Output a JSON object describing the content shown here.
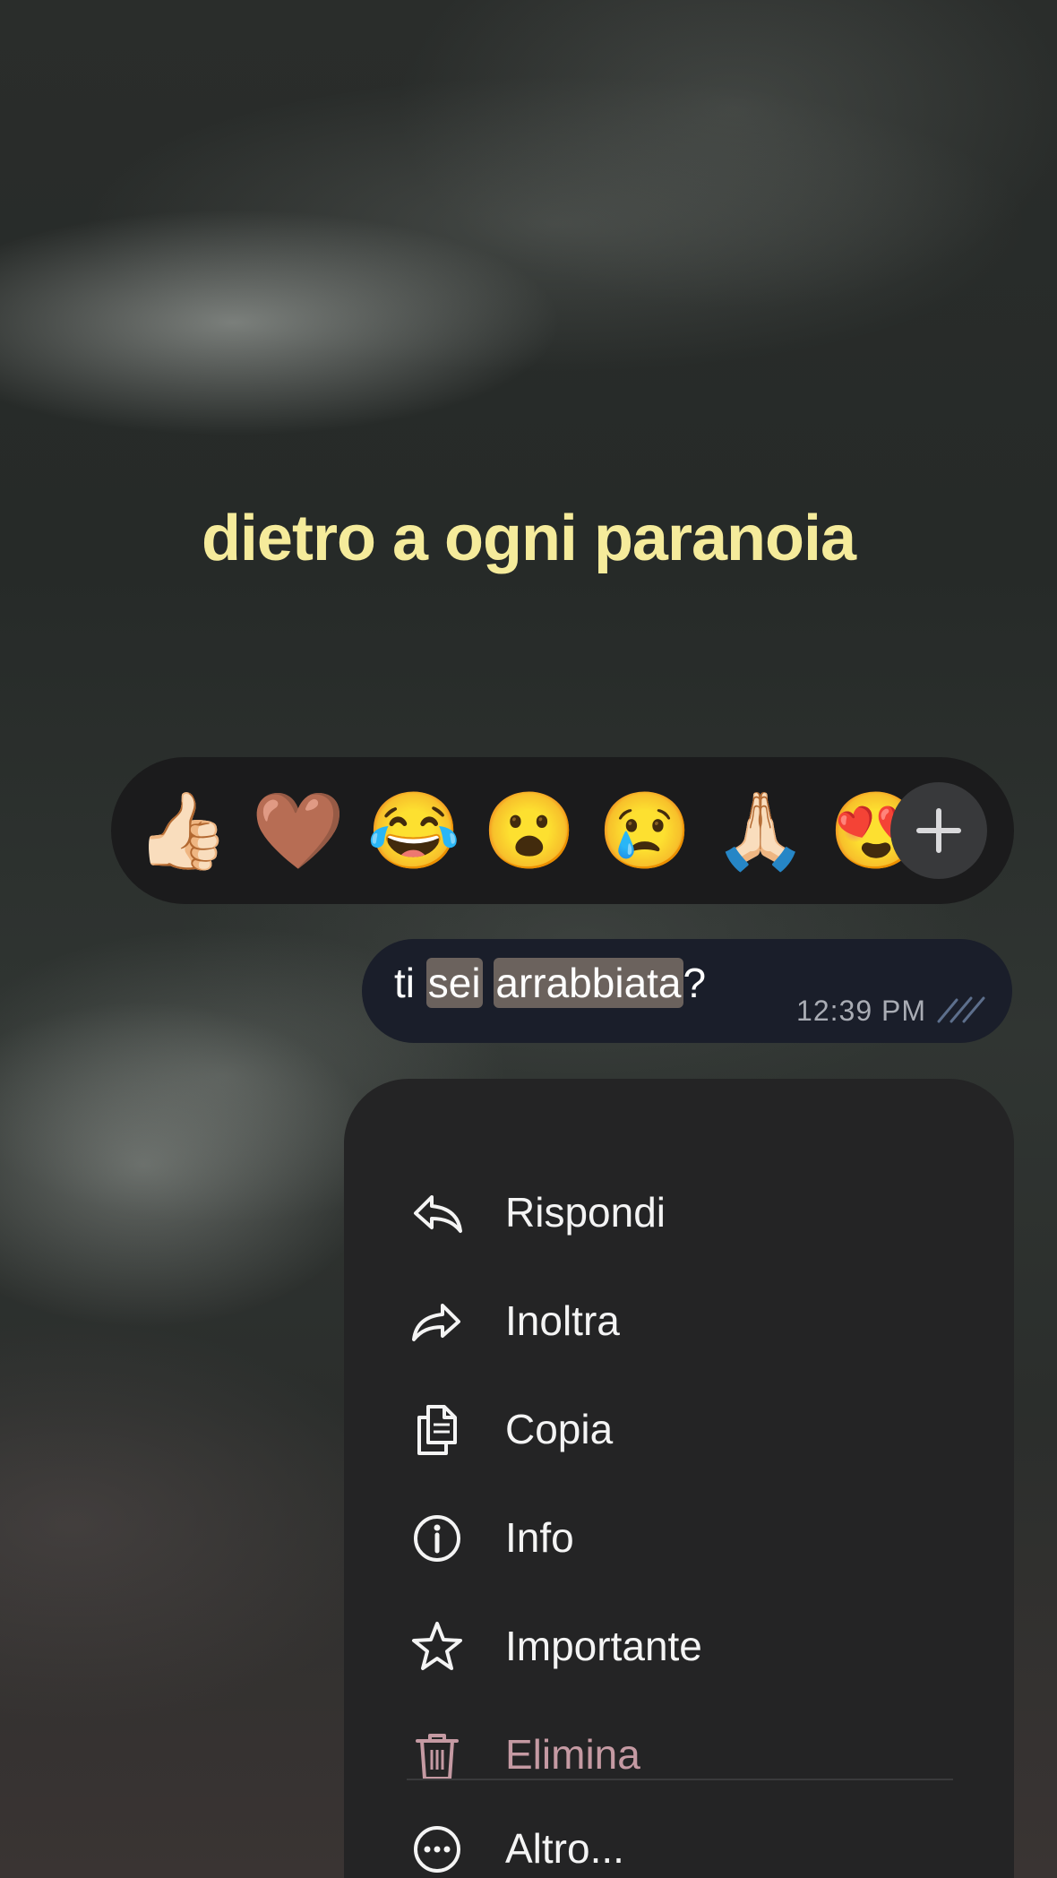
{
  "overlay": {
    "caption": "dietro a ogni paranoia",
    "caption_color": "#f5eb9b"
  },
  "reactions": {
    "items": [
      {
        "emoji": "👍🏻",
        "icon": "thumbs-up"
      },
      {
        "emoji": "🤎",
        "icon": "heart"
      },
      {
        "emoji": "😂",
        "icon": "tears-of-joy"
      },
      {
        "emoji": "😮",
        "icon": "surprised"
      },
      {
        "emoji": "😢",
        "icon": "crying"
      },
      {
        "emoji": "🙏🏻",
        "icon": "folded-hands"
      },
      {
        "emoji": "😍",
        "icon": "heart-eyes"
      }
    ],
    "add_icon": "plus-icon"
  },
  "message": {
    "parts": {
      "w1": "ti",
      "w2": "sei",
      "w3": "arrabbiata",
      "end": "?"
    },
    "time": "12:39 PM",
    "status_icon": "double-check-icon",
    "highlight_color": "#6b625d"
  },
  "menu": {
    "items": [
      {
        "label": "Rispondi",
        "icon": "reply-icon"
      },
      {
        "label": "Inoltra",
        "icon": "forward-icon"
      },
      {
        "label": "Copia",
        "icon": "copy-icon"
      },
      {
        "label": "Info",
        "icon": "info-icon"
      },
      {
        "label": "Importante",
        "icon": "star-icon"
      },
      {
        "label": "Elimina",
        "icon": "trash-icon",
        "color": "#c59aa3"
      },
      {
        "label": "Altro...",
        "icon": "more-icon"
      }
    ]
  }
}
